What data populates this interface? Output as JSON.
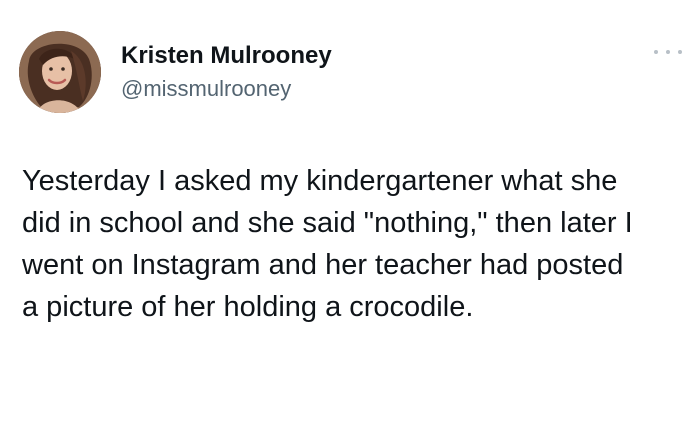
{
  "author": {
    "display_name": "Kristen Mulrooney",
    "handle": "@missmulrooney",
    "avatar_icon": "profile-photo"
  },
  "more_icon": "more-horizontal-icon",
  "tweet": {
    "lines": [
      "Yesterday I asked my kindergartener what she",
      "did in school and she said \"nothing,\" then later I",
      "went on Instagram and her teacher had posted",
      "a picture of her holding a crocodile."
    ]
  },
  "colors": {
    "text": "#0f1419",
    "secondary_text": "#536471",
    "background": "#ffffff"
  }
}
